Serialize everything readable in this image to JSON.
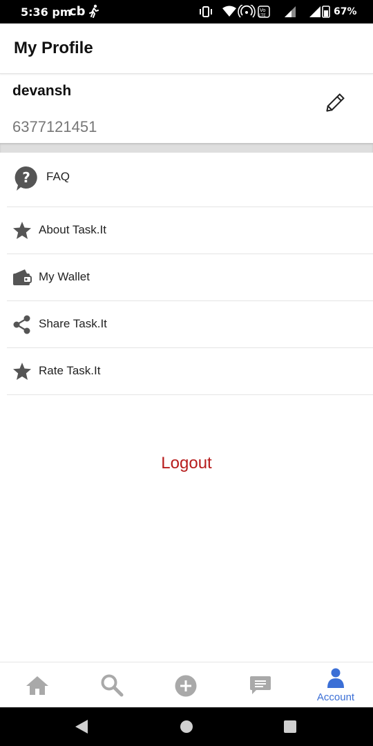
{
  "status_bar": {
    "time": "5:36 pm",
    "carrier_text": "cb",
    "battery_percent": "67%",
    "icons": [
      "runner-icon",
      "vibrate-icon",
      "wifi-icon",
      "hotspot-icon",
      "volte-icon",
      "signal-icon",
      "signal-icon",
      "battery-icon"
    ]
  },
  "header": {
    "title": "My Profile"
  },
  "profile": {
    "name": "devansh",
    "phone": "6377121451",
    "edit_icon": "pencil-icon"
  },
  "menu": {
    "items": [
      {
        "label": "FAQ",
        "icon": "question-bubble-icon"
      },
      {
        "label": "About Task.It",
        "icon": "star-icon"
      },
      {
        "label": "My Wallet",
        "icon": "wallet-icon"
      },
      {
        "label": "Share Task.It",
        "icon": "share-icon"
      },
      {
        "label": "Rate Task.It",
        "icon": "star-icon"
      }
    ]
  },
  "logout_label": "Logout",
  "bottom_nav": {
    "items": [
      {
        "icon": "home-icon",
        "label": ""
      },
      {
        "icon": "search-icon",
        "label": ""
      },
      {
        "icon": "add-circle-icon",
        "label": ""
      },
      {
        "icon": "chat-icon",
        "label": ""
      },
      {
        "icon": "person-icon",
        "label": "Account",
        "active": true
      }
    ],
    "active_color": "#3b6fd6",
    "inactive_color": "#a9a9a9"
  },
  "colors": {
    "logout": "#b71c1c",
    "icon": "#555555",
    "divider_band": "#dedede"
  }
}
